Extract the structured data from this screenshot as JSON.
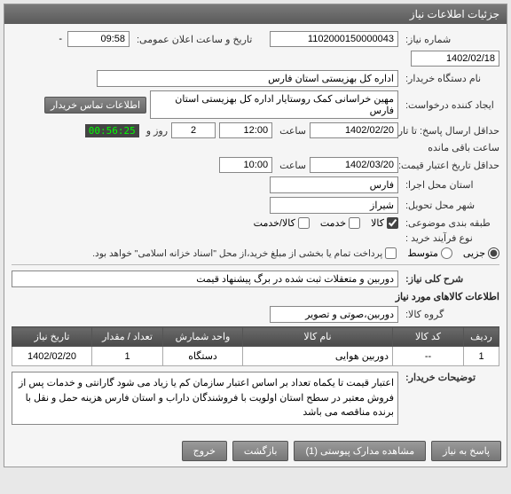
{
  "panel": {
    "title": "جزئیات اطلاعات نیاز"
  },
  "labels": {
    "need_no": "شماره نیاز:",
    "announce_dt": "تاریخ و ساعت اعلان عمومی:",
    "buyer_org": "نام دستگاه خریدار:",
    "requester": "ایجاد کننده درخواست:",
    "deadline": "حداقل ارسال پاسخ: تا تاریخ:",
    "validity": "حداقل تاریخ اعتبار قیمت: تا تاریخ:",
    "exec_province": "استان محل اجرا:",
    "delivery_city": "شهر محل تحویل:",
    "classification": "طبقه بندی موضوعی:",
    "purchase_type": "نوع فرآیند خرید :",
    "need_summary": "شرح کلی نیاز:",
    "goods_info": "اطلاعات کالاهای مورد نیاز",
    "goods_group": "گروه کالا:",
    "buyer_notes": "توضیحات خریدار:",
    "hour": "ساعت",
    "day_and": "روز و",
    "remaining": "ساعت باقی مانده",
    "contact_btn": "اطلاعات تماس خریدار"
  },
  "fields": {
    "need_no": "1102000150000043",
    "announce_date": "1402/02/18",
    "announce_time": "09:58",
    "buyer_org": "اداره کل بهزیستی استان فارس",
    "requester": "مهین خراسانی کمک روستایار اداره کل بهزیستی استان فارس",
    "deadline_date": "1402/02/20",
    "deadline_time": "12:00",
    "remaining_days": "2",
    "remaining_timer": "00:56:25",
    "validity_date": "1402/03/20",
    "validity_time": "10:00",
    "exec_province": "فارس",
    "delivery_city": "شیراز",
    "need_summary": "دوربین و متعقلات ثبت شده در برگ پیشنهاد قیمت",
    "goods_group": "دوربین،صوتی و تصویر",
    "buyer_notes": "اعتبار قیمت تا یکماه تعداد بر اساس اعتبار سازمان کم یا زیاد می شود گارانتی و خدمات پس از فروش معتبر در سطح استان اولویت با فروشندگان داراب و استان فارس هزینه حمل و نقل با برنده مناقصه می باشد"
  },
  "classification": {
    "goods": {
      "label": "کالا",
      "checked": true
    },
    "service": {
      "label": "خدمت",
      "checked": false
    },
    "goods_service": {
      "label": "کالا/خدمت",
      "checked": false
    }
  },
  "purchase": {
    "minor": {
      "label": "جزیی",
      "checked": true
    },
    "medium": {
      "label": "متوسط",
      "checked": false
    },
    "note": "پرداخت تمام یا بخشی از مبلغ خرید،از محل \"اسناد خزانه اسلامی\" خواهد بود."
  },
  "table": {
    "headers": {
      "row": "ردیف",
      "code": "کد کالا",
      "name": "نام کالا",
      "unit": "واحد شمارش",
      "qty": "تعداد / مقدار",
      "date": "تاریخ نیاز"
    },
    "rows": {
      "0": {
        "row": "1",
        "code": "--",
        "name": "دوربین هوایی",
        "unit": "دستگاه",
        "qty": "1",
        "date": "1402/02/20"
      }
    }
  },
  "footer": {
    "respond": "پاسخ به نیاز",
    "attachments": "مشاهده مدارک پیوستی (1)",
    "back": "بازگشت",
    "exit": "خروج"
  },
  "dash": " - "
}
